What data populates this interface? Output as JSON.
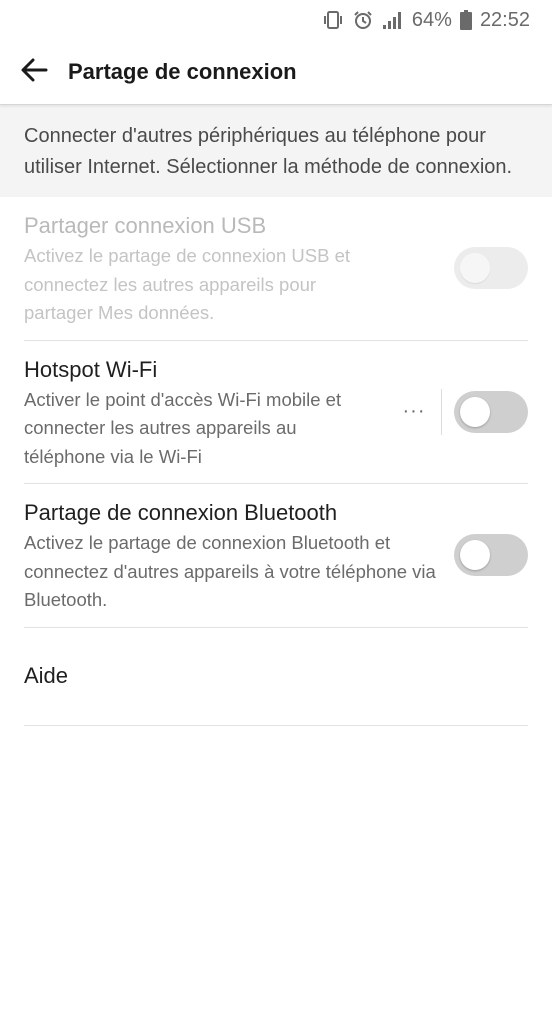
{
  "status_bar": {
    "battery_percent": "64%",
    "time": "22:52",
    "icons": [
      "vibrate-icon",
      "alarm-icon",
      "signal-icon",
      "battery-icon"
    ]
  },
  "app_bar": {
    "title": "Partage de connexion",
    "back_icon": "arrow-left-icon"
  },
  "intro_text": "Connecter d'autres périphériques au téléphone pour utiliser Internet. Sélectionner la méthode de connexion.",
  "settings": [
    {
      "title": "Partager connexion USB",
      "description": "Activez le partage de connexion USB et connectez les autres appareils pour partager Mes données.",
      "enabled": false,
      "toggle_on": false
    },
    {
      "title": "Hotspot Wi-Fi",
      "description": "Activer le point d'accès Wi-Fi mobile et connecter les autres appareils au téléphone via le Wi-Fi",
      "more_label": "···",
      "enabled": true,
      "toggle_on": false
    },
    {
      "title": "Partage de connexion Bluetooth",
      "description": "Activez le partage de connexion Bluetooth et connectez d'autres appareils à votre téléphone via Bluetooth.",
      "enabled": true,
      "toggle_on": false
    }
  ],
  "help": {
    "label": "Aide"
  },
  "colors": {
    "background": "#ffffff",
    "intro_bg": "#f4f4f4",
    "toggle_off": "#cfcfcf",
    "text_primary": "#1f1f1f",
    "text_secondary": "#6b6b6b",
    "text_disabled": "#b9b9b9"
  }
}
